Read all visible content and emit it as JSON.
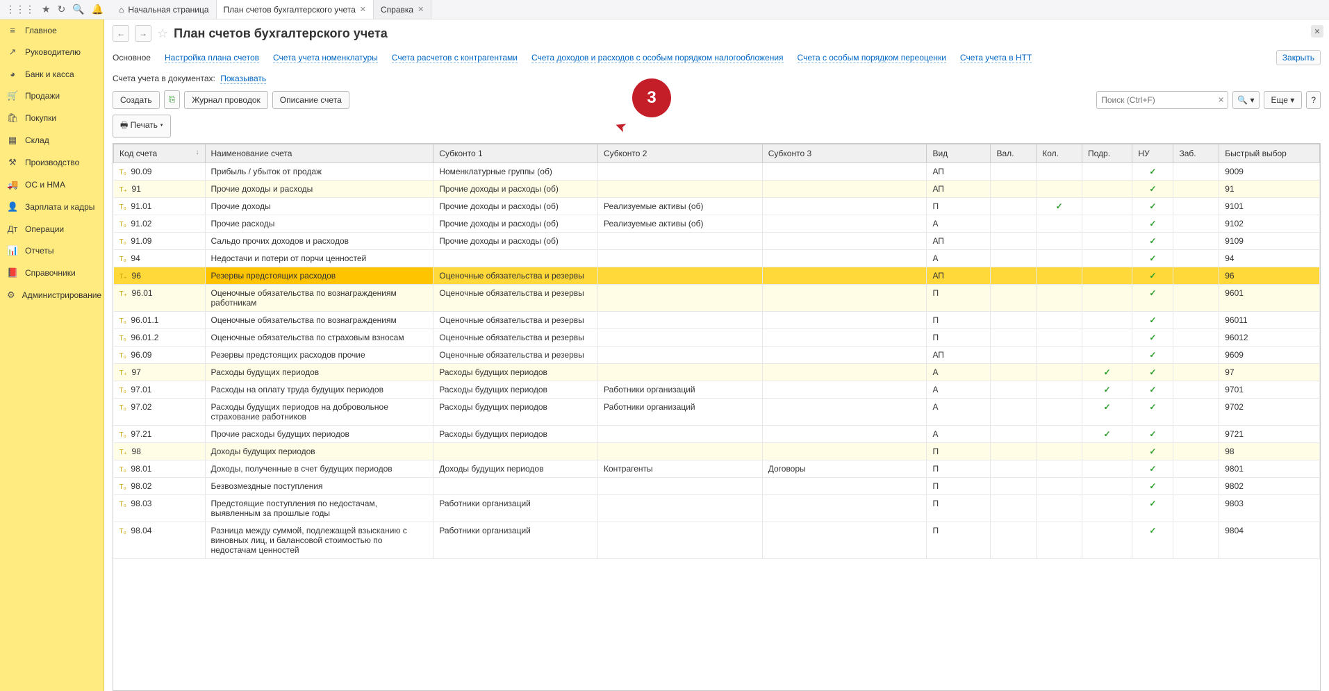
{
  "topbar": {
    "tabs": [
      {
        "label": "Начальная страница",
        "home": true
      },
      {
        "label": "План счетов бухгалтерского учета",
        "active": true,
        "closable": true
      },
      {
        "label": "Справка",
        "closable": true
      }
    ]
  },
  "sidebar": {
    "items": [
      {
        "icon": "≡",
        "label": "Главное"
      },
      {
        "icon": "↗",
        "label": "Руководителю"
      },
      {
        "icon": "◕",
        "label": "Банк и касса"
      },
      {
        "icon": "🛒",
        "label": "Продажи"
      },
      {
        "icon": "🛍",
        "label": "Покупки"
      },
      {
        "icon": "▦",
        "label": "Склад"
      },
      {
        "icon": "⚒",
        "label": "Производство"
      },
      {
        "icon": "🚚",
        "label": "ОС и НМА"
      },
      {
        "icon": "👤",
        "label": "Зарплата и кадры"
      },
      {
        "icon": "Дт",
        "label": "Операции"
      },
      {
        "icon": "📊",
        "label": "Отчеты"
      },
      {
        "icon": "📕",
        "label": "Справочники"
      },
      {
        "icon": "⚙",
        "label": "Администрирование"
      }
    ]
  },
  "header": {
    "title": "План счетов бухгалтерского учета",
    "links": [
      "Основное",
      "Настройка плана счетов",
      "Счета учета номенклатуры",
      "Счета расчетов с контрагентами",
      "Счета доходов и расходов с особым порядком налогообложения",
      "Счета с особым порядком переоценки",
      "Счета учета в НТТ"
    ],
    "close_label": "Закрыть",
    "info_label": "Счета учета в документах:",
    "info_link": "Показывать"
  },
  "toolbar": {
    "create": "Создать",
    "journal": "Журнал проводок",
    "desc": "Описание счета",
    "search_placeholder": "Поиск (Ctrl+F)",
    "more": "Еще",
    "print": "Печать"
  },
  "annotation": {
    "number": "3"
  },
  "columns": [
    "Код счета",
    "Наименование счета",
    "Субконто 1",
    "Субконто 2",
    "Субконто 3",
    "Вид",
    "Вал.",
    "Кол.",
    "Подр.",
    "НУ",
    "Заб.",
    "Быстрый выбор"
  ],
  "rows": [
    {
      "grp": false,
      "code": "90.09",
      "name": "Прибыль / убыток от продаж",
      "s1": "Номенклатурные группы (об)",
      "s2": "",
      "s3": "",
      "vid": "АП",
      "val": "",
      "kol": "",
      "pod": "",
      "nu": true,
      "zab": "",
      "fast": "9009"
    },
    {
      "grp": true,
      "code": "91",
      "name": "Прочие доходы и расходы",
      "s1": "Прочие доходы и расходы (об)",
      "s2": "",
      "s3": "",
      "vid": "АП",
      "val": "",
      "kol": "",
      "pod": "",
      "nu": true,
      "zab": "",
      "fast": "91"
    },
    {
      "grp": false,
      "code": "91.01",
      "name": "Прочие доходы",
      "s1": "Прочие доходы и расходы (об)",
      "s2": "Реализуемые активы (об)",
      "s3": "",
      "vid": "П",
      "val": "",
      "kol": true,
      "pod": "",
      "nu": true,
      "zab": "",
      "fast": "9101"
    },
    {
      "grp": false,
      "code": "91.02",
      "name": "Прочие расходы",
      "s1": "Прочие доходы и расходы (об)",
      "s2": "Реализуемые активы (об)",
      "s3": "",
      "vid": "А",
      "val": "",
      "kol": "",
      "pod": "",
      "nu": true,
      "zab": "",
      "fast": "9102"
    },
    {
      "grp": false,
      "code": "91.09",
      "name": "Сальдо прочих доходов и расходов",
      "s1": "Прочие доходы и расходы (об)",
      "s2": "",
      "s3": "",
      "vid": "АП",
      "val": "",
      "kol": "",
      "pod": "",
      "nu": true,
      "zab": "",
      "fast": "9109"
    },
    {
      "grp": false,
      "code": "94",
      "name": "Недостачи и потери от порчи ценностей",
      "s1": "",
      "s2": "",
      "s3": "",
      "vid": "А",
      "val": "",
      "kol": "",
      "pod": "",
      "nu": true,
      "zab": "",
      "fast": "94"
    },
    {
      "grp": true,
      "sel": true,
      "code": "96",
      "name": "Резервы предстоящих расходов",
      "s1": "Оценочные обязательства и резервы",
      "s2": "",
      "s3": "",
      "vid": "АП",
      "val": "",
      "kol": "",
      "pod": "",
      "nu": true,
      "zab": "",
      "fast": "96"
    },
    {
      "grp": true,
      "code": "96.01",
      "name": "Оценочные обязательства по вознаграждениям работникам",
      "s1": "Оценочные обязательства и резервы",
      "s2": "",
      "s3": "",
      "vid": "П",
      "val": "",
      "kol": "",
      "pod": "",
      "nu": true,
      "zab": "",
      "fast": "9601"
    },
    {
      "grp": false,
      "code": "96.01.1",
      "name": "Оценочные обязательства по вознаграждениям",
      "s1": "Оценочные обязательства и резервы",
      "s2": "",
      "s3": "",
      "vid": "П",
      "val": "",
      "kol": "",
      "pod": "",
      "nu": true,
      "zab": "",
      "fast": "96011"
    },
    {
      "grp": false,
      "code": "96.01.2",
      "name": "Оценочные обязательства по страховым взносам",
      "s1": "Оценочные обязательства и резервы",
      "s2": "",
      "s3": "",
      "vid": "П",
      "val": "",
      "kol": "",
      "pod": "",
      "nu": true,
      "zab": "",
      "fast": "96012"
    },
    {
      "grp": false,
      "code": "96.09",
      "name": "Резервы предстоящих расходов прочие",
      "s1": "Оценочные обязательства и резервы",
      "s2": "",
      "s3": "",
      "vid": "АП",
      "val": "",
      "kol": "",
      "pod": "",
      "nu": true,
      "zab": "",
      "fast": "9609"
    },
    {
      "grp": true,
      "code": "97",
      "name": "Расходы будущих периодов",
      "s1": "Расходы будущих периодов",
      "s2": "",
      "s3": "",
      "vid": "А",
      "val": "",
      "kol": "",
      "pod": true,
      "nu": true,
      "zab": "",
      "fast": "97"
    },
    {
      "grp": false,
      "code": "97.01",
      "name": "Расходы на оплату труда будущих периодов",
      "s1": "Расходы будущих периодов",
      "s2": "Работники организаций",
      "s3": "",
      "vid": "А",
      "val": "",
      "kol": "",
      "pod": true,
      "nu": true,
      "zab": "",
      "fast": "9701"
    },
    {
      "grp": false,
      "code": "97.02",
      "name": "Расходы будущих периодов на добровольное страхование работников",
      "s1": "Расходы будущих периодов",
      "s2": "Работники организаций",
      "s3": "",
      "vid": "А",
      "val": "",
      "kol": "",
      "pod": true,
      "nu": true,
      "zab": "",
      "fast": "9702"
    },
    {
      "grp": false,
      "code": "97.21",
      "name": "Прочие расходы будущих периодов",
      "s1": "Расходы будущих периодов",
      "s2": "",
      "s3": "",
      "vid": "А",
      "val": "",
      "kol": "",
      "pod": true,
      "nu": true,
      "zab": "",
      "fast": "9721"
    },
    {
      "grp": true,
      "code": "98",
      "name": "Доходы будущих периодов",
      "s1": "",
      "s2": "",
      "s3": "",
      "vid": "П",
      "val": "",
      "kol": "",
      "pod": "",
      "nu": true,
      "zab": "",
      "fast": "98"
    },
    {
      "grp": false,
      "code": "98.01",
      "name": "Доходы, полученные в счет будущих периодов",
      "s1": "Доходы будущих периодов",
      "s2": "Контрагенты",
      "s3": "Договоры",
      "vid": "П",
      "val": "",
      "kol": "",
      "pod": "",
      "nu": true,
      "zab": "",
      "fast": "9801"
    },
    {
      "grp": false,
      "code": "98.02",
      "name": "Безвозмездные поступления",
      "s1": "",
      "s2": "",
      "s3": "",
      "vid": "П",
      "val": "",
      "kol": "",
      "pod": "",
      "nu": true,
      "zab": "",
      "fast": "9802"
    },
    {
      "grp": false,
      "code": "98.03",
      "name": "Предстоящие поступления по недостачам, выявленным за прошлые годы",
      "s1": "Работники организаций",
      "s2": "",
      "s3": "",
      "vid": "П",
      "val": "",
      "kol": "",
      "pod": "",
      "nu": true,
      "zab": "",
      "fast": "9803"
    },
    {
      "grp": false,
      "code": "98.04",
      "name": "Разница между суммой, подлежащей взысканию с виновных лиц, и балансовой стоимостью по недостачам ценностей",
      "s1": "Работники организаций",
      "s2": "",
      "s3": "",
      "vid": "П",
      "val": "",
      "kol": "",
      "pod": "",
      "nu": true,
      "zab": "",
      "fast": "9804"
    }
  ]
}
